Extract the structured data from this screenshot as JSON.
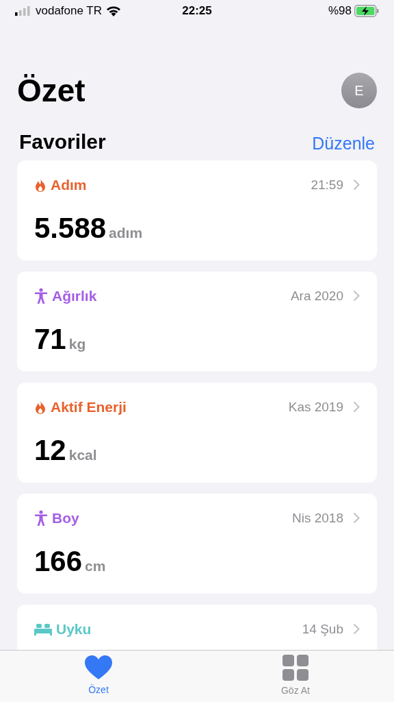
{
  "status_bar": {
    "carrier": "vodafone TR",
    "time": "22:25",
    "battery": "%98"
  },
  "header": {
    "title": "Özet",
    "avatar": "E"
  },
  "section": {
    "title": "Favoriler",
    "action": "Düzenle"
  },
  "cards": [
    {
      "kind": "flame",
      "title": "Adım",
      "color": "#e8612c",
      "date": "21:59",
      "value": "5.588",
      "unit": "adım"
    },
    {
      "kind": "figure",
      "title": "Ağırlık",
      "color": "#a45ee5",
      "date": "Ara 2020",
      "value": "71",
      "unit": "kg"
    },
    {
      "kind": "flame",
      "title": "Aktif Enerji",
      "color": "#e8612c",
      "date": "Kas 2019",
      "value": "12",
      "unit": "kcal"
    },
    {
      "kind": "figure",
      "title": "Boy",
      "color": "#a45ee5",
      "date": "Nis 2018",
      "value": "166",
      "unit": "cm"
    },
    {
      "kind": "bed",
      "title": "Uyku",
      "color": "#5ac8c8",
      "date": "14 Şub"
    }
  ],
  "tab_bar": [
    {
      "kind": "heart",
      "label": "Özet",
      "selected": true
    },
    {
      "kind": "grid",
      "label": "Göz At",
      "selected": false
    }
  ]
}
